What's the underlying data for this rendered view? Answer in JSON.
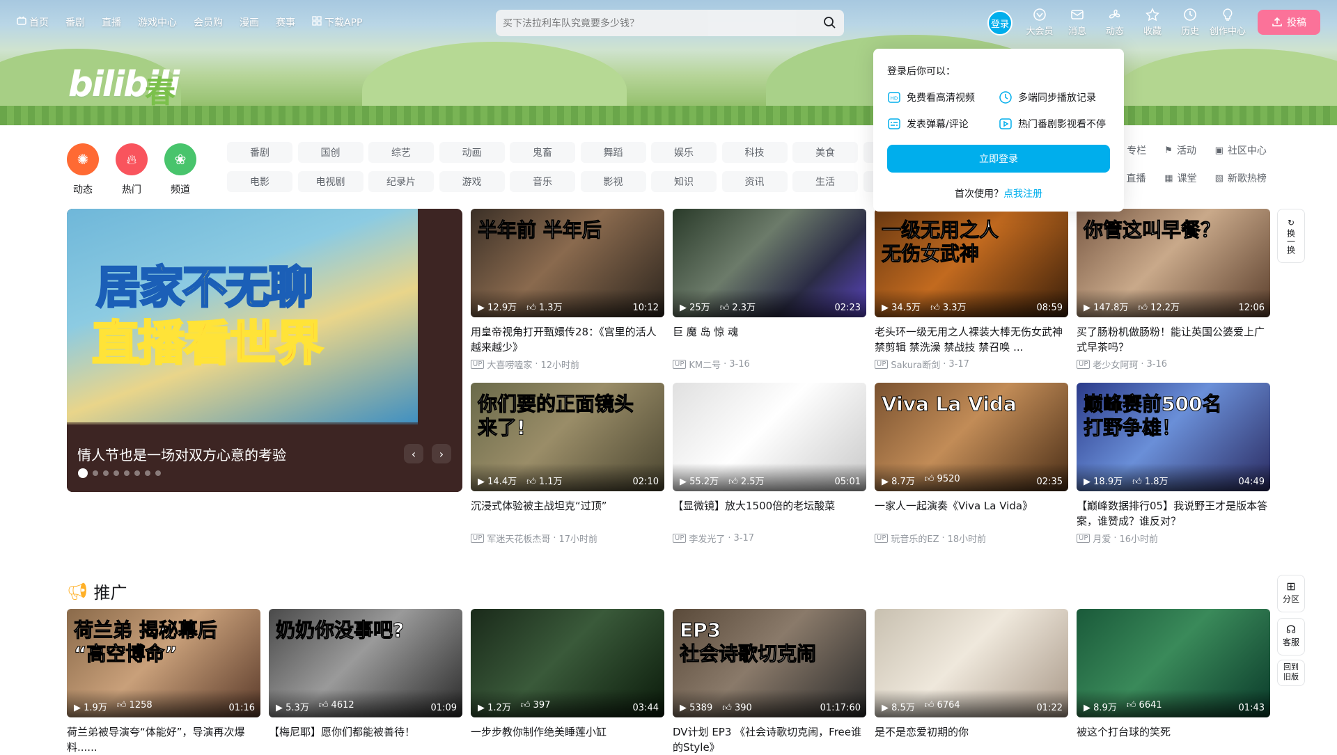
{
  "nav": {
    "left": [
      {
        "label": "首页",
        "icon": "tv-icon"
      },
      {
        "label": "番剧"
      },
      {
        "label": "直播"
      },
      {
        "label": "游戏中心"
      },
      {
        "label": "会员购"
      },
      {
        "label": "漫画"
      },
      {
        "label": "赛事"
      },
      {
        "label": "下载APP",
        "icon": "app-icon"
      }
    ],
    "search_placeholder": "买下法拉利车队究竟要多少钱？",
    "login": "登录",
    "right": [
      {
        "label": "大会员",
        "icon": "vip-icon"
      },
      {
        "label": "消息",
        "icon": "mail-icon"
      },
      {
        "label": "动态",
        "icon": "fan-icon"
      },
      {
        "label": "收藏",
        "icon": "star-icon"
      },
      {
        "label": "历史",
        "icon": "clock-icon"
      },
      {
        "label": "创作中心",
        "icon": "bulb-icon"
      }
    ],
    "upload": "投稿"
  },
  "banner": {
    "logo": "bilibili",
    "logo_char": "春"
  },
  "channels": {
    "icons": [
      {
        "label": "动态",
        "color": "#ff6a33",
        "icon": "fan-icon"
      },
      {
        "label": "热门",
        "color": "#f9545d",
        "icon": "fire-icon"
      },
      {
        "label": "频道",
        "color": "#48c46c",
        "icon": "channels-icon"
      }
    ],
    "tags": [
      "番剧",
      "国创",
      "综艺",
      "动画",
      "鬼畜",
      "舞蹈",
      "娱乐",
      "科技",
      "美食",
      "",
      "电影",
      "电视剧",
      "纪录片",
      "游戏",
      "音乐",
      "影视",
      "知识",
      "资讯",
      "生活",
      ""
    ],
    "right": [
      {
        "label": "专栏",
        "icon": "column-icon"
      },
      {
        "label": "活动",
        "icon": "flag-icon"
      },
      {
        "label": "社区中心",
        "icon": "community-icon"
      },
      {
        "label": "直播",
        "icon": "live-icon"
      },
      {
        "label": "课堂",
        "icon": "class-icon"
      },
      {
        "label": "新歌热榜",
        "icon": "music-icon"
      }
    ]
  },
  "carousel": {
    "line1": "居家不无聊",
    "line2": "直播看世界",
    "caption": "情人节也是一场对双方心意的考验",
    "dots": 8,
    "active": 0
  },
  "videos": [
    {
      "title": "用皇帝视角打开甄嬛传28：《宫里的活人越来越少》",
      "author": "大喜唠嗑家",
      "time": "12小时前",
      "views": "12.9万",
      "likes": "1.3万",
      "dur": "10:12",
      "overlay": "半年前        半年后",
      "bg": "linear-gradient(135deg,#3b3027,#8a6a4e 45%,#2b241d)"
    },
    {
      "title": "巨 魔 岛 惊 魂",
      "author": "KM二号",
      "time": "3-16",
      "views": "25万",
      "likes": "2.3万",
      "dur": "02:23",
      "overlay": "",
      "bg": "linear-gradient(135deg,#2a3b2a,#6c7b6a 40%,#2b2c46 70%,#5b45c3)"
    },
    {
      "title": "老头环一级无用之人裸装大棒无伤女武神 禁剪辑 禁洗澡 禁战技 禁召唤 ...",
      "author": "Sakura断剑",
      "time": "3-17",
      "views": "34.5万",
      "likes": "3.3万",
      "dur": "08:59",
      "overlay": "一级无用之人\n无伤女武神",
      "bg": "linear-gradient(135deg,#6b3a12,#c26a1f 45%,#3a1f0a)"
    },
    {
      "title": "买了肠粉机做肠粉！能让英国公婆爱上广式早茶吗？",
      "author": "老少女阿珂",
      "time": "3-16",
      "views": "147.8万",
      "likes": "12.2万",
      "dur": "12:06",
      "overlay": "你管这叫早餐？",
      "bg": "linear-gradient(135deg,#7a5a45,#c9a98a 45%,#5a3e2c)"
    },
    {
      "title": "沉浸式体验被主战坦克“过顶”",
      "author": "军迷天花板杰哥",
      "time": "17小时前",
      "views": "14.4万",
      "likes": "1.1万",
      "dur": "02:10",
      "overlay": "你们要的正面镜头\n来了!",
      "bg": "linear-gradient(135deg,#6a6a4a,#9a8d68 45%,#4a4530)"
    },
    {
      "title": "【显微镜】放大1500倍的老坛酸菜",
      "author": "李发光了",
      "time": "3-17",
      "views": "55.2万",
      "likes": "2.5万",
      "dur": "05:01",
      "overlay": "",
      "bg": "linear-gradient(135deg,#e0e0e0,#ffffff 45%,#c8c8c8)"
    },
    {
      "title": "一家人一起演奏《Viva La Vida》",
      "author": "玩音乐的EZ",
      "time": "18小时前",
      "views": "8.7万",
      "likes": "9520",
      "dur": "02:35",
      "overlay": "Viva La Vida",
      "bg": "linear-gradient(135deg,#7a5230,#c28c57 45%,#4a2e17)"
    },
    {
      "title": "【巅峰数据排行05】我说野王才是版本答案，谁赞成？谁反对？",
      "author": "月爱",
      "time": "16小时前",
      "views": "18.9万",
      "likes": "1.8万",
      "dur": "04:49",
      "overlay": "巅峰赛前500名\n打野争雄！",
      "bg": "linear-gradient(135deg,#2b3b8a,#6a8fd8 45%,#2a2a60)"
    }
  ],
  "section": {
    "title": "推广",
    "icon": "megaphone-icon"
  },
  "promos": [
    {
      "title": "荷兰弟被导演夸“体能好”，导演再次爆料......",
      "views": "1.9万",
      "likes": "1258",
      "dur": "01:16",
      "overlay": "荷兰弟 揭秘幕后\n“高空博命”",
      "bg": "linear-gradient(135deg,#8a6a4a,#c9a07a 45%,#5a3a2a)"
    },
    {
      "title": "【梅尼耶】愿你们都能被善待！",
      "views": "5.3万",
      "likes": "4612",
      "dur": "01:09",
      "overlay": "奶奶你没事吧?",
      "bg": "linear-gradient(135deg,#4a4a4a,#9a9a9a 45%,#2a2a2a)"
    },
    {
      "title": "一步步教你制作绝美睡莲小缸",
      "views": "1.2万",
      "likes": "397",
      "dur": "03:44",
      "overlay": "",
      "bg": "linear-gradient(135deg,#1a2a1a,#3a5a3a 45%,#0a1a0a)"
    },
    {
      "title": "DV计划 EP3 《社会诗歌切克闹，Free谁的Style》",
      "views": "5389",
      "likes": "390",
      "dur": "01:17:60",
      "overlay": "EP3\n社会诗歌切克闹",
      "bg": "linear-gradient(135deg,#5a4a3a,#8a7a6a 45%,#2a2a2a)"
    },
    {
      "title": "是不是恋爱初期的你",
      "views": "8.5万",
      "likes": "6764",
      "dur": "01:22",
      "overlay": "",
      "bg": "linear-gradient(135deg,#c8c0b0,#efe8dc 45%,#a89888)"
    },
    {
      "title": "被这个打台球的笑死",
      "views": "8.9万",
      "likes": "6641",
      "dur": "01:43",
      "overlay": "",
      "bg": "linear-gradient(135deg,#1a5a3a,#3a8a5a 45%,#0a3a2a)"
    }
  ],
  "popup": {
    "heading": "登录后你可以：",
    "items": [
      {
        "label": "免费看高清视频",
        "icon": "hd-icon"
      },
      {
        "label": "多端同步播放记录",
        "icon": "clock-icon"
      },
      {
        "label": "发表弹幕/评论",
        "icon": "danmaku-icon"
      },
      {
        "label": "热门番剧影视看不停",
        "icon": "play-icon"
      }
    ],
    "button": "立即登录",
    "reg_text": "首次使用？",
    "reg_link": "点我注册"
  },
  "side": {
    "refresh": "换一换",
    "zone": "分区",
    "service": "客服",
    "old": "回到旧版"
  }
}
